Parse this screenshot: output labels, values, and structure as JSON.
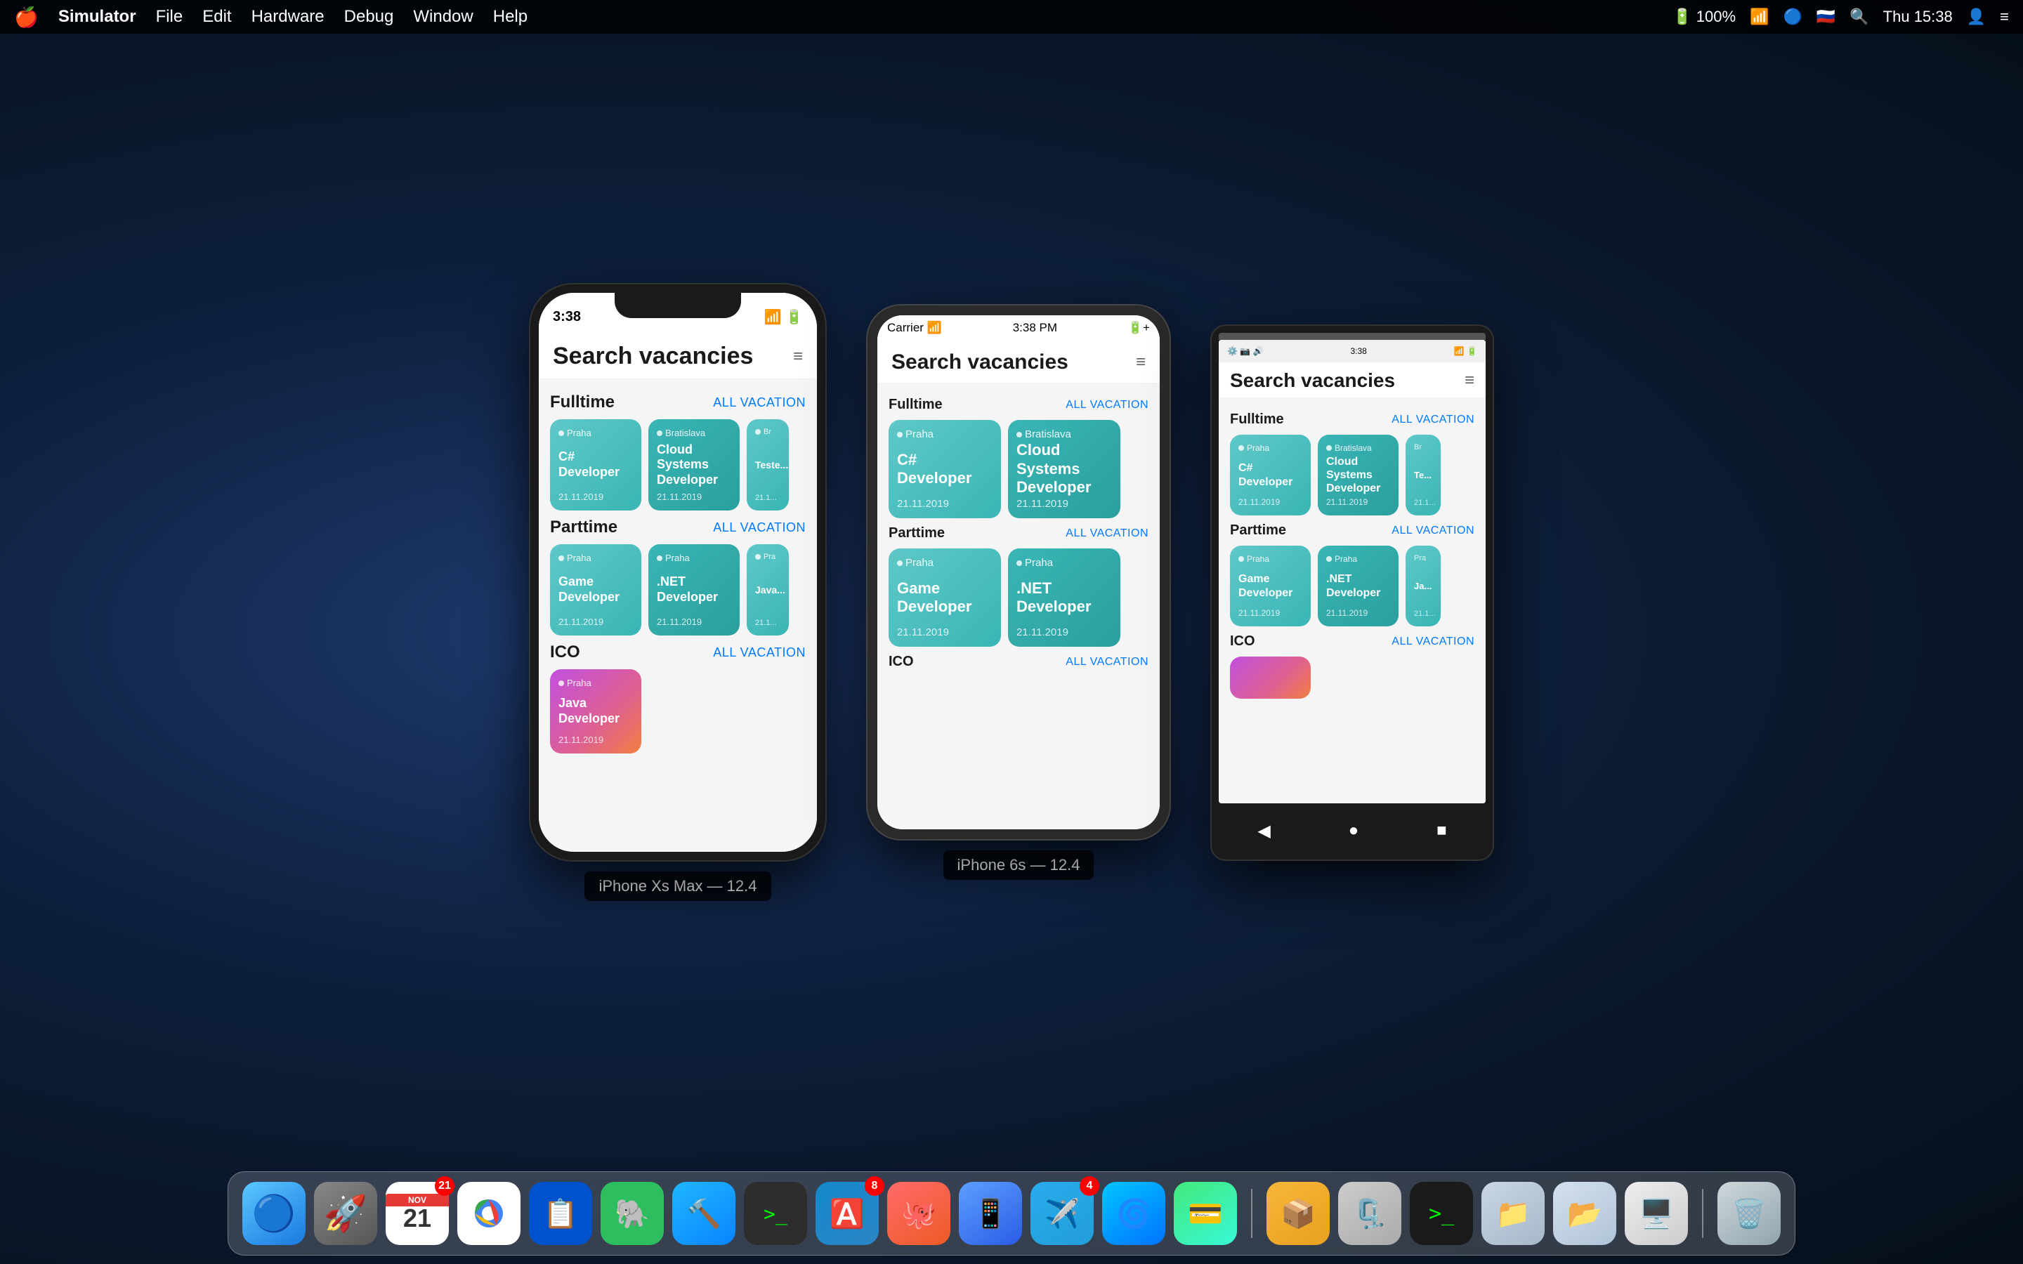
{
  "desktop": {
    "menubar": {
      "apple": "🍎",
      "items": [
        "Simulator",
        "File",
        "Edit",
        "Hardware",
        "Debug",
        "Window",
        "Help"
      ],
      "right": {
        "battery": "100%",
        "time": "Thu 15:38",
        "wifi": "WiFi",
        "bluetooth": "BT",
        "flag": "🇷🇺"
      }
    }
  },
  "devices": {
    "iphone_xs_max": {
      "label": "iPhone Xs Max — 12.4",
      "statusbar": {
        "time": "3:38",
        "battery": "■■■",
        "wifi": "WiFi"
      },
      "app": {
        "title": "Search vacancies",
        "filter_icon": "≡",
        "sections": [
          {
            "title": "Fulltime",
            "link": "ALL VACATION",
            "cards": [
              {
                "location": "Praha",
                "title": "C# Developer",
                "date": "21.11.2019",
                "style": "teal"
              },
              {
                "location": "Bratislava",
                "title": "Cloud Systems Developer",
                "date": "21.11.2019",
                "style": "teal2"
              },
              {
                "location": "Br...",
                "title": "Testo...",
                "date": "21.2...",
                "style": "teal"
              }
            ]
          },
          {
            "title": "Parttime",
            "link": "ALL VACATION",
            "cards": [
              {
                "location": "Praha",
                "title": "Game Developer",
                "date": "21.11.2019",
                "style": "teal"
              },
              {
                "location": "Praha",
                "title": ".NET Developer",
                "date": "21.11.2019",
                "style": "teal2"
              },
              {
                "location": "Pra...",
                "title": "Java...",
                "date": "21.11...",
                "style": "teal"
              }
            ]
          },
          {
            "title": "ICO",
            "link": "ALL VACATION",
            "cards": [
              {
                "location": "Praha",
                "title": "Java Developer",
                "date": "21.11.2019",
                "style": "coral"
              }
            ]
          }
        ]
      }
    },
    "iphone_6s": {
      "label": "iPhone 6s — 12.4",
      "statusbar": {
        "carrier": "Carrier",
        "time": "3:38 PM",
        "battery": "🔋+"
      },
      "app": {
        "title": "Search vacancies",
        "filter_icon": "≡",
        "sections": [
          {
            "title": "Fulltime",
            "link": "ALL VACATION",
            "cards": [
              {
                "location": "Praha",
                "title": "C# Developer",
                "date": "21.11.2019",
                "style": "teal"
              },
              {
                "location": "Bratislava",
                "title": "Cloud Systems Developer",
                "date": "21.11.2019",
                "style": "teal2"
              }
            ]
          },
          {
            "title": "Parttime",
            "link": "ALL VACATION",
            "cards": [
              {
                "location": "Praha",
                "title": "Game Developer",
                "date": "21.11.2019",
                "style": "teal"
              },
              {
                "location": "Praha",
                "title": ".NET Developer",
                "date": "21.11.2019",
                "style": "teal2"
              }
            ]
          },
          {
            "title": "ICO",
            "link": "ALL VACATION",
            "cards": []
          }
        ]
      }
    },
    "android": {
      "statusbar": {
        "time": "3:38",
        "battery": "🔋"
      },
      "app": {
        "title": "Search vacancies",
        "filter_icon": "≡",
        "sections": [
          {
            "title": "Fulltime",
            "link": "ALL VACATION",
            "cards": [
              {
                "location": "Praha",
                "title": "C# Developer",
                "date": "21.11.2019",
                "style": "teal"
              },
              {
                "location": "Bratislava",
                "title": "Cloud Systems Developer",
                "date": "21.11.2019",
                "style": "teal2"
              },
              {
                "location": "Br...",
                "title": "Te...",
                "date": "21.1...",
                "style": "teal"
              }
            ]
          },
          {
            "title": "Parttime",
            "link": "ALL VACATION",
            "cards": [
              {
                "location": "Praha",
                "title": "Game Developer",
                "date": "21.11.2019",
                "style": "teal"
              },
              {
                "location": "Praha",
                "title": ".NET Developer",
                "date": "21.11.2019",
                "style": "teal2"
              },
              {
                "location": "Pra...",
                "title": "Ja...",
                "date": "21.1...",
                "style": "teal"
              }
            ]
          },
          {
            "title": "ICO",
            "link": "ALL VACATION",
            "cards": []
          }
        ]
      },
      "nav": {
        "back": "◀",
        "home": "●",
        "recent": "■"
      }
    }
  },
  "dock": {
    "icons": [
      {
        "name": "finder",
        "emoji": "🔵",
        "label": "Finder"
      },
      {
        "name": "rocket",
        "emoji": "🚀",
        "label": "Launchpad"
      },
      {
        "name": "calendar",
        "emoji": "📅",
        "label": "Calendar",
        "badge": "21"
      },
      {
        "name": "chrome",
        "emoji": "🌐",
        "label": "Chrome"
      },
      {
        "name": "trello",
        "emoji": "📋",
        "label": "Trello"
      },
      {
        "name": "evernote",
        "emoji": "🐘",
        "label": "Evernote"
      },
      {
        "name": "xcode",
        "emoji": "⚒️",
        "label": "Xcode"
      },
      {
        "name": "terminal",
        "emoji": "⬛",
        "label": "Terminal"
      },
      {
        "name": "appstore",
        "emoji": "🅰️",
        "label": "App Store",
        "badge": "8"
      },
      {
        "name": "store2",
        "emoji": "🐙",
        "label": "Canister"
      },
      {
        "name": "simulator",
        "emoji": "📱",
        "label": "Simulator"
      },
      {
        "name": "telegram",
        "emoji": "✈️",
        "label": "Telegram",
        "badge": "4"
      },
      {
        "name": "cursor",
        "emoji": "🌀",
        "label": "Cursor"
      },
      {
        "name": "money",
        "emoji": "💰",
        "label": "Money"
      },
      {
        "name": "archive",
        "emoji": "📦",
        "label": "Archive"
      },
      {
        "name": "zip",
        "emoji": "🗜️",
        "label": "Zip"
      },
      {
        "name": "term2",
        "emoji": "💻",
        "label": "Terminal2"
      },
      {
        "name": "files",
        "emoji": "📁",
        "label": "Files"
      },
      {
        "name": "files2",
        "emoji": "📂",
        "label": "Files2"
      },
      {
        "name": "finder2",
        "emoji": "🖥️",
        "label": "Finder2"
      },
      {
        "name": "trash",
        "emoji": "🗑️",
        "label": "Trash"
      }
    ]
  }
}
